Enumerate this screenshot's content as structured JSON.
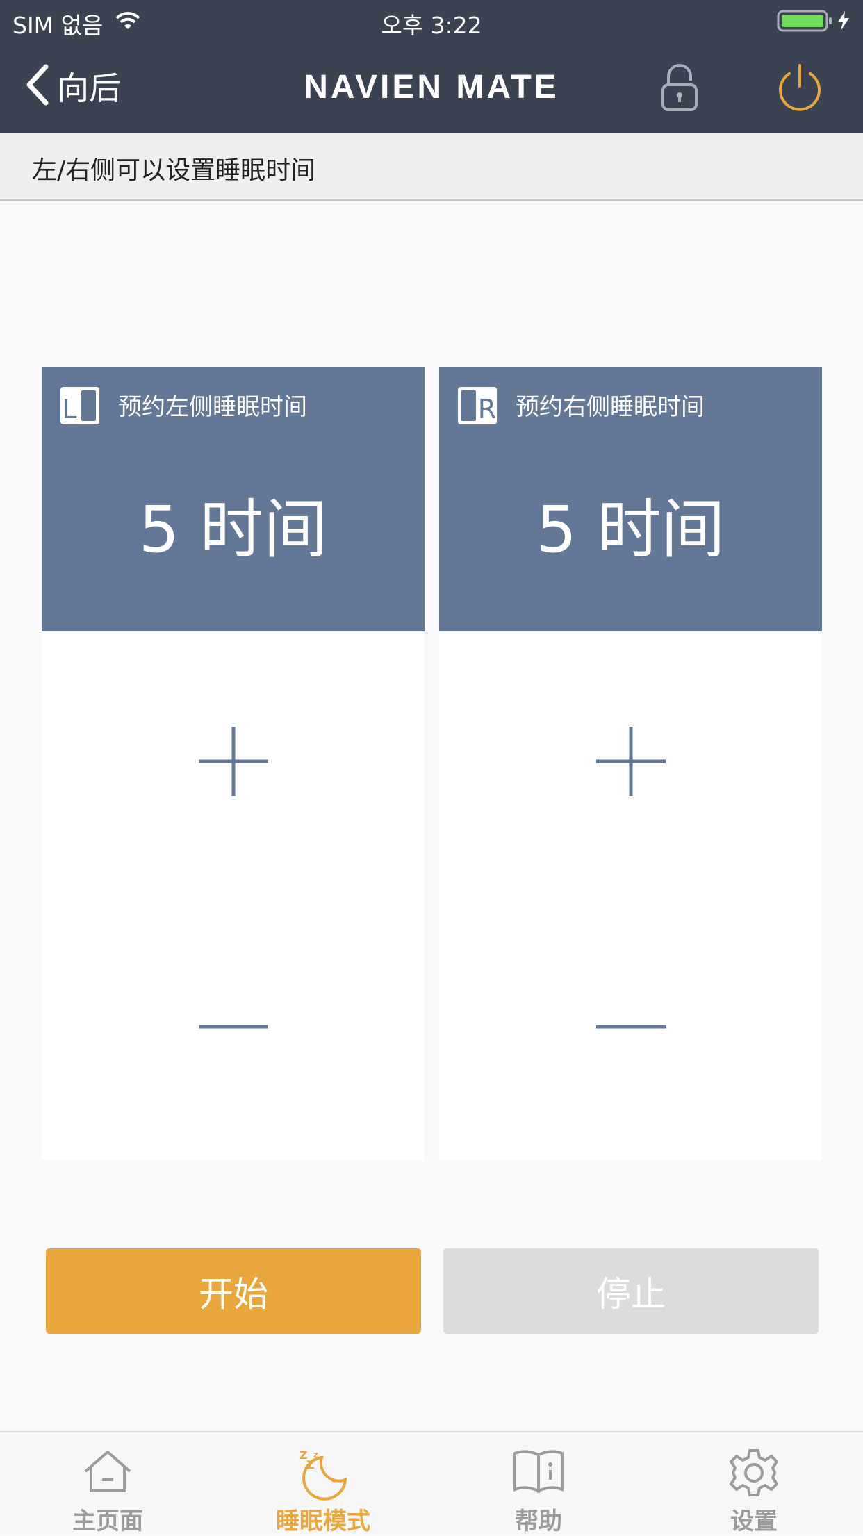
{
  "status_bar": {
    "carrier": "SIM 없음",
    "time": "오후 3:22"
  },
  "nav": {
    "back_label": "向后",
    "brand": "NAVIEN MATE"
  },
  "subheader": "左/右侧可以设置睡眠时间",
  "panels": {
    "left": {
      "title": "预约左侧睡眠时间",
      "value": "5 时间",
      "side_letter": "L"
    },
    "right": {
      "title": "预约右侧睡眠时间",
      "value": "5 时间",
      "side_letter": "R"
    }
  },
  "buttons": {
    "start": "开始",
    "stop": "停止"
  },
  "tabs": [
    {
      "label": "主页面",
      "icon": "home-icon",
      "active": false
    },
    {
      "label": "睡眠模式",
      "icon": "sleep-moon-icon",
      "active": true
    },
    {
      "label": "帮助",
      "icon": "help-book-icon",
      "active": false
    },
    {
      "label": "设置",
      "icon": "gear-icon",
      "active": false
    }
  ],
  "colors": {
    "header": "#3b4252",
    "panel": "#637796",
    "accent": "#e8a63c",
    "disabled": "#dcdcdc",
    "battery": "#6fdc5a"
  }
}
